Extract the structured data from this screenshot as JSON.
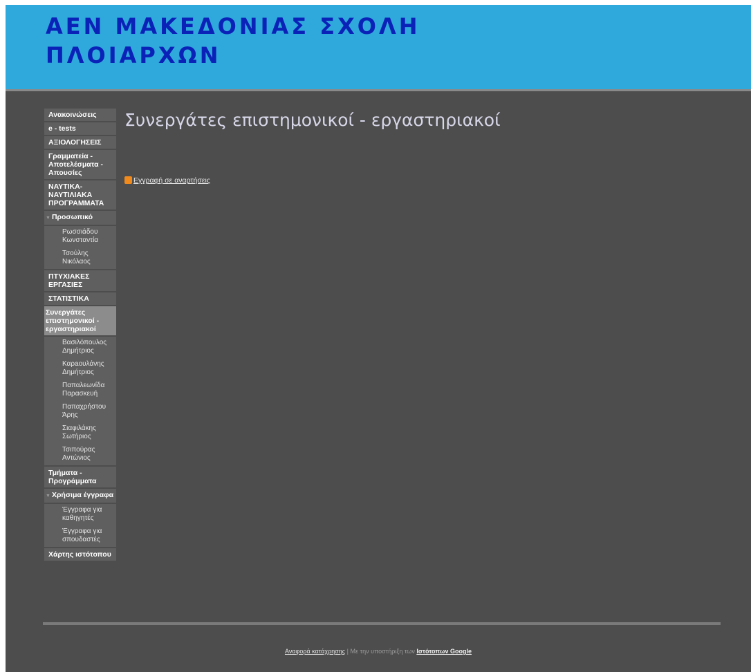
{
  "header": {
    "title_line1": "ΑΕΝ ΜΑΚΕΔΟΝΙΑΣ ΣΧΟΛΗ",
    "title_line2": "ΠΛΟΙΑΡΧΩΝ"
  },
  "sidebar": {
    "items": [
      {
        "label": "Ανακοινώσεις"
      },
      {
        "label": "e - tests"
      },
      {
        "label": "ΑΞΙΟΛΟΓΗΣΕΙΣ"
      },
      {
        "label": "Γραμματεία - Αποτελέσματα - Απουσίες"
      },
      {
        "label": "ΝΑΥΤΙΚΑ-ΝΑΥΤΙΛΙΑΚΑ ΠΡΟΓΡΑΜΜΑΤΑ"
      },
      {
        "label": "Προσωπικό",
        "children": [
          "Ρωσσιάδου Κωνσταντία",
          "Τσούλης Νικόλαος"
        ]
      },
      {
        "label": "ΠΤΥΧΙΑΚΕΣ ΕΡΓΑΣΙΕΣ"
      },
      {
        "label": "ΣΤΑΤΙΣΤΙΚΑ"
      },
      {
        "label": "Συνεργάτες επιστημονικοί - εργαστηριακοί",
        "children": [
          "Βασιλόπουλος Δημήτριος",
          "Καρaουλάνης Δημήτριος",
          "Παπαλεωνίδα Παρασκευή",
          "Παπαχρήστου Άρης",
          "Σιαφιλάκης Σωτήριος",
          "Τσιπούρας Αντώνιος"
        ]
      },
      {
        "label": "Τμήματα - Προγράμματα"
      },
      {
        "label": "Χρήσιμα έγγραφα",
        "children": [
          "Έγγραφα για καθηγητές",
          "Έγγραφα για σπουδαστές"
        ]
      },
      {
        "label": "Χάρτης ιστότοπου"
      }
    ]
  },
  "main": {
    "page_title": "Συνεργάτες επιστημονικοί - εργαστηριακοί",
    "subscribe_label": "Εγγραφή σε αναρτήσεις"
  },
  "footer": {
    "report_link": "Αναφορά κατάχρησης",
    "separator": "|",
    "powered_text": "Με την υποστήριξη των",
    "google_link": "Ιστότοπων Google"
  },
  "colors": {
    "header_bg": "#2fa9dc",
    "title_color": "#0b22b8",
    "page_bg": "#4d4d4d",
    "active_item_bg": "#8c8c8c",
    "rss_icon": "#f08a1c"
  }
}
